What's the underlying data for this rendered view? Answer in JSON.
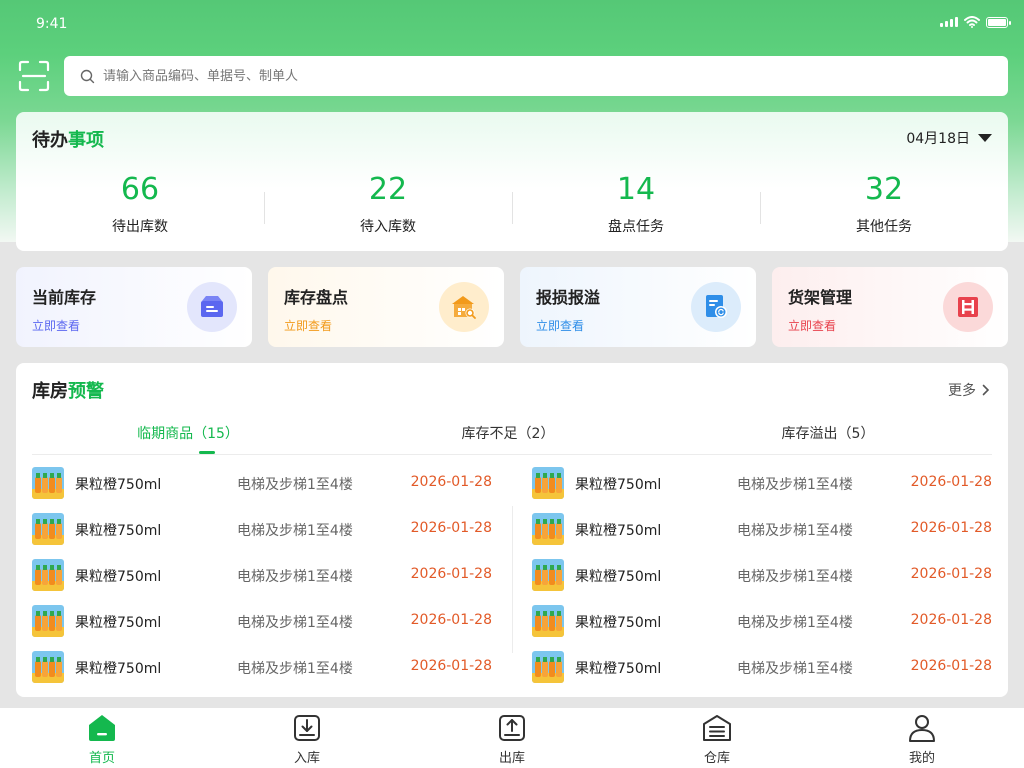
{
  "status": {
    "time": "9:41"
  },
  "search": {
    "placeholder": "请输入商品编码、单据号、制单人"
  },
  "todo": {
    "title_prefix": "待办",
    "title_highlight": "事项",
    "date": "04月18日",
    "stats": [
      {
        "value": "66",
        "label": "待出库数"
      },
      {
        "value": "22",
        "label": "待入库数"
      },
      {
        "value": "14",
        "label": "盘点任务"
      },
      {
        "value": "32",
        "label": "其他任务"
      }
    ]
  },
  "quick": [
    {
      "title": "当前库存",
      "link": "立即查看",
      "color": "#5b67f0",
      "bg": "#eef0fe"
    },
    {
      "title": "库存盘点",
      "link": "立即查看",
      "color": "#f29a1b",
      "bg": "#fff4df"
    },
    {
      "title": "报损报溢",
      "link": "立即查看",
      "color": "#2f8ee8",
      "bg": "#e8f3fd"
    },
    {
      "title": "货架管理",
      "link": "立即查看",
      "color": "#e8424d",
      "bg": "#fde3e3"
    }
  ],
  "warning": {
    "title_prefix": "库房",
    "title_highlight": "预警",
    "more": "更多",
    "tabs": [
      "临期商品（15）",
      "库存不足（2）",
      "库存溢出（5）"
    ],
    "items_left": [
      {
        "name": "果粒橙750ml",
        "location": "电梯及步梯1至4楼",
        "date": "2026-01-28"
      },
      {
        "name": "果粒橙750ml",
        "location": "电梯及步梯1至4楼",
        "date": "2026-01-28"
      },
      {
        "name": "果粒橙750ml",
        "location": "电梯及步梯1至4楼",
        "date": "2026-01-28"
      },
      {
        "name": "果粒橙750ml",
        "location": "电梯及步梯1至4楼",
        "date": "2026-01-28"
      },
      {
        "name": "果粒橙750ml",
        "location": "电梯及步梯1至4楼",
        "date": "2026-01-28"
      }
    ],
    "items_right": [
      {
        "name": "果粒橙750ml",
        "location": "电梯及步梯1至4楼",
        "date": "2026-01-28"
      },
      {
        "name": "果粒橙750ml",
        "location": "电梯及步梯1至4楼",
        "date": "2026-01-28"
      },
      {
        "name": "果粒橙750ml",
        "location": "电梯及步梯1至4楼",
        "date": "2026-01-28"
      },
      {
        "name": "果粒橙750ml",
        "location": "电梯及步梯1至4楼",
        "date": "2026-01-28"
      },
      {
        "name": "果粒橙750ml",
        "location": "电梯及步梯1至4楼",
        "date": "2026-01-28"
      }
    ]
  },
  "nav": [
    {
      "label": "首页",
      "icon": "home-icon"
    },
    {
      "label": "入库",
      "icon": "inbound-icon"
    },
    {
      "label": "出库",
      "icon": "outbound-icon"
    },
    {
      "label": "仓库",
      "icon": "warehouse-icon"
    },
    {
      "label": "我的",
      "icon": "user-icon"
    }
  ],
  "theme": {
    "accent": "#14b84e",
    "date_color": "#e25a28"
  }
}
